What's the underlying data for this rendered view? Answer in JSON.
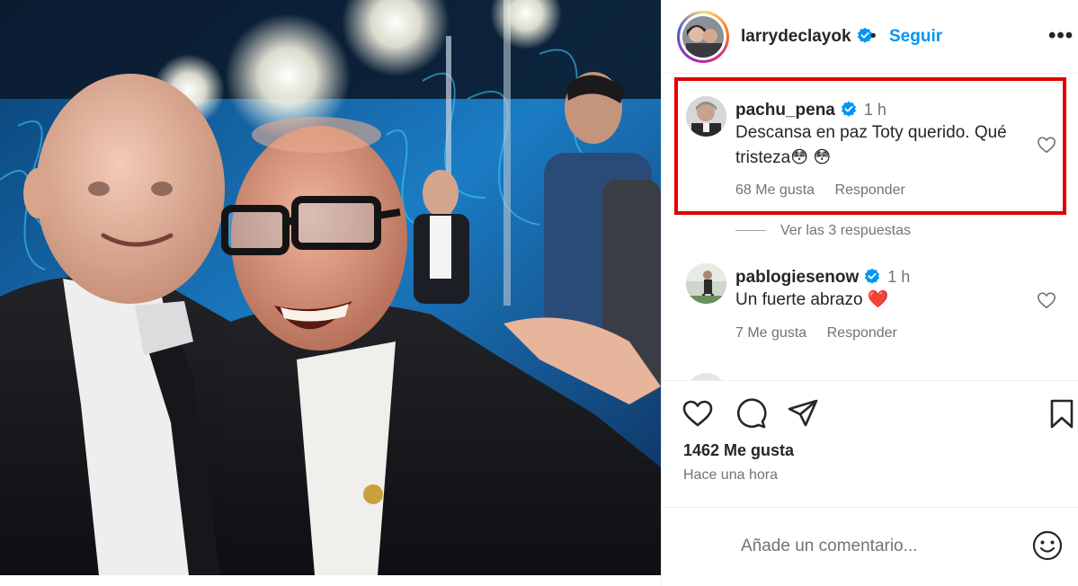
{
  "post": {
    "author": "larrydeclayok",
    "follow_label": "Seguir",
    "dot": "•",
    "more_label": "•••",
    "likes_text": "1462 Me gusta",
    "posted_ago": "Hace una hora"
  },
  "comments": [
    {
      "user": "pachu_pena",
      "time": "1 h",
      "text": "Descansa en paz Toty querido. Qué tristeza😳 😳",
      "likes": "68 Me gusta",
      "reply_label": "Responder",
      "highlighted": true
    },
    {
      "user": "pablogiesenow",
      "time": "1 h",
      "text": "Un fuerte abrazo ❤️",
      "likes": "7 Me gusta",
      "reply_label": "Responder"
    }
  ],
  "replies_toggle": "Ver las 3 respuestas",
  "add_comment": {
    "placeholder": "Añade un comentario..."
  },
  "icons": {
    "like": "heart-icon",
    "comment": "comment-icon",
    "share": "send-icon",
    "save": "bookmark-icon",
    "emoji": "emoji-icon",
    "verified": "verified-badge-icon"
  },
  "colors": {
    "follow": "#0095f6",
    "verified": "#0095f6",
    "highlight_box": "#e00000",
    "heart_emoji": "#e0245e"
  }
}
